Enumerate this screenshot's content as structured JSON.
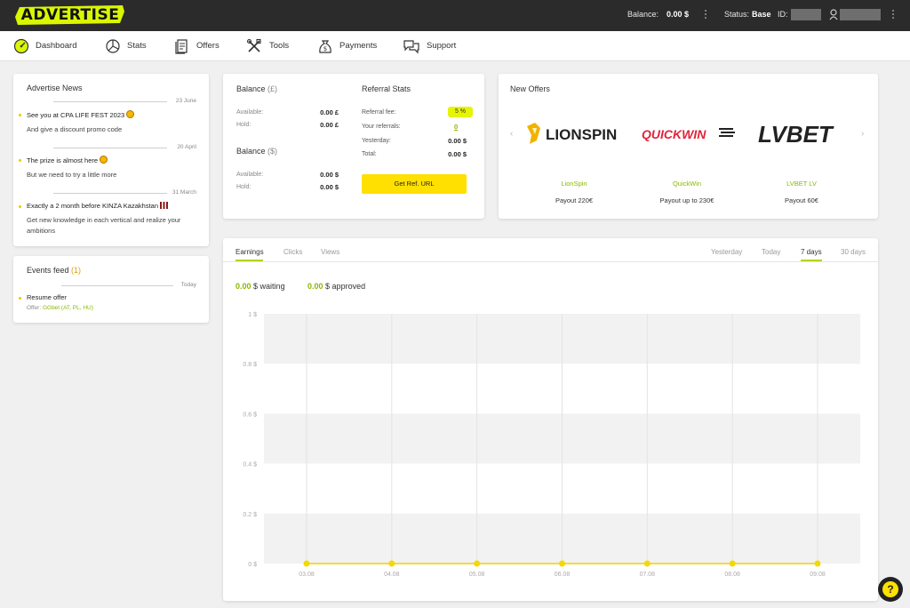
{
  "header": {
    "logo_text": "ADVERTISE",
    "balance_label": "Balance:",
    "balance_value": "0.00 $",
    "status_label": "Status:",
    "status_value": "Base",
    "id_label": "ID:"
  },
  "nav": [
    {
      "label": "Dashboard",
      "icon": "dashboard-icon"
    },
    {
      "label": "Stats",
      "icon": "pie-chart-icon"
    },
    {
      "label": "Offers",
      "icon": "document-icon"
    },
    {
      "label": "Tools",
      "icon": "tools-icon"
    },
    {
      "label": "Payments",
      "icon": "money-bag-icon"
    },
    {
      "label": "Support",
      "icon": "chat-bubbles-icon"
    }
  ],
  "news": {
    "title": "Advertise News",
    "items": [
      {
        "date": "23 June",
        "title": "See you at CPA LIFE FEST 2023",
        "text": "And give a discount promo code"
      },
      {
        "date": "20 April",
        "title": "The prize is almost here",
        "text": "But we need to try a little more"
      },
      {
        "date": "31 March",
        "title": "Exactly a 2 month before KINZA Kazakhstan",
        "text": "Get new knowledge in each vertical and realize your ambitions"
      }
    ]
  },
  "events": {
    "title": "Events feed",
    "count": "(1)",
    "date": "Today",
    "item_title": "Resume offer",
    "offer_label": "Offer:",
    "offer_value": "GGbet (AT, PL, HU)"
  },
  "balance": {
    "gbp_title": "Balance",
    "gbp_unit": "(£)",
    "gbp_available_label": "Available:",
    "gbp_available": "0.00 £",
    "gbp_hold_label": "Hold:",
    "gbp_hold": "0.00 £",
    "usd_title": "Balance",
    "usd_unit": "($)",
    "usd_available_label": "Available:",
    "usd_available": "0.00 $",
    "usd_hold_label": "Hold:",
    "usd_hold": "0.00 $"
  },
  "referral": {
    "title": "Referral Stats",
    "fee_label": "Referral fee:",
    "fee_value": "5 %",
    "referrals_label": "Your referrals:",
    "referrals_value": "0",
    "yesterday_label": "Yesterday:",
    "yesterday_value": "0.00 $",
    "total_label": "Total:",
    "total_value": "0.00 $",
    "button_label": "Get Ref. URL"
  },
  "offers": {
    "title": "New Offers",
    "items": [
      {
        "logo": "LIONSPIN",
        "name": "LionSpin",
        "payout": "Payout 220€"
      },
      {
        "logo": "QUICKWIN",
        "name": "QuickWin",
        "payout": "Payout up to 230€"
      },
      {
        "logo": "LVBET",
        "name": "LVBET LV",
        "payout": "Payout 60€"
      }
    ]
  },
  "chart_tabs": {
    "left": [
      "Earnings",
      "Clicks",
      "Views"
    ],
    "right": [
      "Yesterday",
      "Today",
      "7 days",
      "30 days"
    ],
    "active_left": "Earnings",
    "active_right": "7 days"
  },
  "summary": {
    "waiting_value": "0.00",
    "waiting_label": "$ waiting",
    "approved_value": "0.00",
    "approved_label": "$ approved"
  },
  "colors": {
    "accent": "#e6f500",
    "green": "#8ab800",
    "line": "#f0d000"
  },
  "chart_data": {
    "type": "line",
    "x": [
      "03.08",
      "04.08",
      "05.08",
      "06.08",
      "07.08",
      "08.08",
      "09.08"
    ],
    "series": [
      {
        "values": [
          0,
          0,
          0,
          0,
          0,
          0,
          0
        ]
      }
    ],
    "yticks": [
      "1 $",
      "0.8 $",
      "0.6 $",
      "0.4 $",
      "0.2 $",
      "0 $"
    ],
    "ylim": [
      0,
      1
    ],
    "grid": true
  }
}
